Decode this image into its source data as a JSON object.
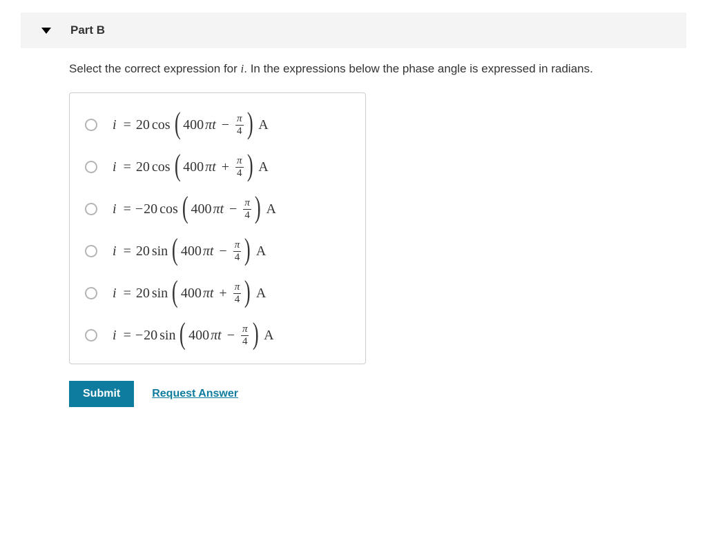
{
  "header": {
    "title": "Part B"
  },
  "prompt": {
    "before_i": "Select the correct expression for ",
    "i": "i",
    "after_i": ". In the expressions below the phase angle is expressed in radians."
  },
  "options": [
    {
      "neg": "",
      "amp": "20",
      "fn": "cos",
      "arg_coef": "400",
      "arg_sym": "πt",
      "op": "−",
      "frac_num": "π",
      "frac_den": "4",
      "unit": "A"
    },
    {
      "neg": "",
      "amp": "20",
      "fn": "cos",
      "arg_coef": "400",
      "arg_sym": "πt",
      "op": "+",
      "frac_num": "π",
      "frac_den": "4",
      "unit": "A"
    },
    {
      "neg": "−",
      "amp": "20",
      "fn": "cos",
      "arg_coef": "400",
      "arg_sym": "πt",
      "op": "−",
      "frac_num": "π",
      "frac_den": "4",
      "unit": "A"
    },
    {
      "neg": "",
      "amp": "20",
      "fn": "sin",
      "arg_coef": "400",
      "arg_sym": "πt",
      "op": "−",
      "frac_num": "π",
      "frac_den": "4",
      "unit": "A"
    },
    {
      "neg": "",
      "amp": "20",
      "fn": "sin",
      "arg_coef": "400",
      "arg_sym": "πt",
      "op": "+",
      "frac_num": "π",
      "frac_den": "4",
      "unit": "A"
    },
    {
      "neg": "−",
      "amp": "20",
      "fn": "sin",
      "arg_coef": "400",
      "arg_sym": "πt",
      "op": "−",
      "frac_num": "π",
      "frac_den": "4",
      "unit": "A"
    }
  ],
  "actions": {
    "submit": "Submit",
    "request": "Request Answer"
  }
}
